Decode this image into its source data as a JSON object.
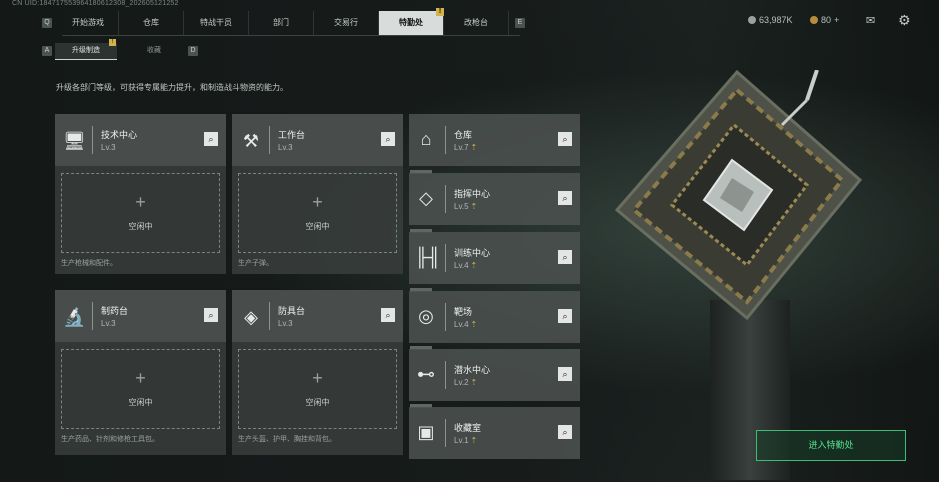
{
  "uid": "CN UID:184717553964180612308_202605121252",
  "nav": {
    "tabs": [
      {
        "label": "开始游戏",
        "active": false
      },
      {
        "label": "仓库",
        "active": false
      },
      {
        "label": "特战干员",
        "active": false
      },
      {
        "label": "部门",
        "active": false
      },
      {
        "label": "交易行",
        "active": false
      },
      {
        "label": "特勤处",
        "active": true,
        "badge": "!"
      },
      {
        "label": "改枪台",
        "active": false
      }
    ],
    "key_left": "Q",
    "key_right": "E"
  },
  "currency": {
    "main": "63,987K",
    "secondary": "80",
    "secondary_plus": "+"
  },
  "subnav": {
    "key_left": "A",
    "key_right": "D",
    "tabs": [
      {
        "label": "升级制造",
        "active": true,
        "badge": "!"
      },
      {
        "label": "收藏",
        "active": false
      }
    ]
  },
  "description": "升级各部门等级，可获得专属能力提升，和制造战斗物资的能力。",
  "workshops": [
    {
      "name": "技术中心",
      "level": "Lv.3",
      "icon": "computer-icon",
      "status": "空闲中",
      "desc": "生产枪械和配件。"
    },
    {
      "name": "工作台",
      "level": "Lv.3",
      "icon": "tools-icon",
      "status": "空闲中",
      "desc": "生产子弹。"
    },
    {
      "name": "制药台",
      "level": "Lv.3",
      "icon": "microscope-icon",
      "status": "空闲中",
      "desc": "生产药品、针剂和修枪工具包。"
    },
    {
      "name": "防具台",
      "level": "Lv.3",
      "icon": "armor-icon",
      "status": "空闲中",
      "desc": "生产头盔、护甲、胸挂和背包。"
    }
  ],
  "departments": [
    {
      "name": "仓库",
      "level": "Lv.7",
      "icon": "warehouse-icon"
    },
    {
      "name": "指挥中心",
      "level": "Lv.5",
      "icon": "command-icon"
    },
    {
      "name": "训练中心",
      "level": "Lv.4",
      "icon": "dumbbell-icon"
    },
    {
      "name": "靶场",
      "level": "Lv.4",
      "icon": "target-icon"
    },
    {
      "name": "潜水中心",
      "level": "Lv.2",
      "icon": "diving-mask-icon"
    },
    {
      "name": "收藏室",
      "level": "Lv.1",
      "icon": "portrait-icon"
    }
  ],
  "enter_button": "进入特勤处",
  "colors": {
    "accent_green": "#56e08f",
    "badge_gold": "#d3b24a",
    "active_tab": "#d8dcda"
  }
}
